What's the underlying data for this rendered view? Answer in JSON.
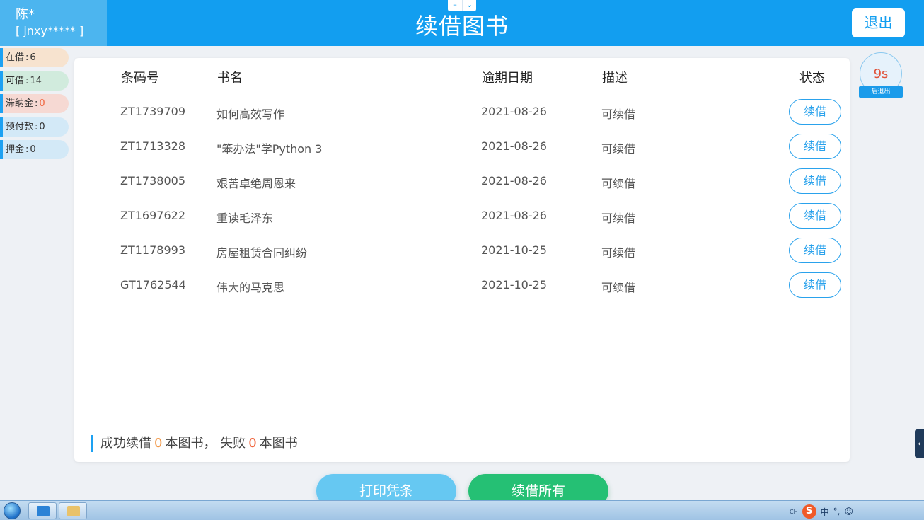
{
  "header": {
    "user_name": "陈*",
    "user_id": "[ jnxy***** ]",
    "title": "续借图书",
    "logout_label": "退出",
    "window_controls": [
      "–",
      "⌄"
    ]
  },
  "stats": [
    {
      "label": "在借",
      "value": "6"
    },
    {
      "label": "可借",
      "value": "14"
    },
    {
      "label": "滞纳金",
      "value": "0"
    },
    {
      "label": "预付款",
      "value": "0"
    },
    {
      "label": "押金",
      "value": "0"
    }
  ],
  "table": {
    "columns": [
      "条码号",
      "书名",
      "逾期日期",
      "描述",
      "状态"
    ],
    "rows": [
      {
        "barcode": "ZT1739709",
        "title": "如何高效写作",
        "due": "2021-08-26",
        "desc": "可续借",
        "action": "续借"
      },
      {
        "barcode": "ZT1713328",
        "title": "\"笨办法\"学Python 3",
        "due": "2021-08-26",
        "desc": "可续借",
        "action": "续借"
      },
      {
        "barcode": "ZT1738005",
        "title": "艰苦卓绝周恩来",
        "due": "2021-08-26",
        "desc": "可续借",
        "action": "续借"
      },
      {
        "barcode": "ZT1697622",
        "title": "重读毛泽东",
        "due": "2021-08-26",
        "desc": "可续借",
        "action": "续借"
      },
      {
        "barcode": "ZT1178993",
        "title": "房屋租赁合同纠纷",
        "due": "2021-10-25",
        "desc": "可续借",
        "action": "续借"
      },
      {
        "barcode": "GT1762544",
        "title": "伟大的马克思",
        "due": "2021-10-25",
        "desc": "可续借",
        "action": "续借"
      }
    ]
  },
  "summary": {
    "prefix": "成功续借",
    "success_count": "0",
    "middle": "本图书， 失败",
    "fail_count": "0",
    "suffix": "本图书"
  },
  "actions": {
    "print_label": "打印凭条",
    "renew_all_label": "续借所有"
  },
  "timer": {
    "value": "9s",
    "label": "后退出"
  },
  "side_tab": "‹",
  "taskbar": {
    "tray_lang": "CH",
    "tray_ime_logo": "S",
    "tray_ime_text": "中",
    "tray_punct": "°,",
    "tray_emoji": "☺"
  },
  "colors": {
    "accent": "#129ef0",
    "alert": "#f0643c",
    "count": "#f2994a",
    "print_button": "#66c8f2",
    "renew_all_button": "#25c074"
  },
  "icons": [
    "window-minimize-icon",
    "window-collapse-icon",
    "windows-start-icon",
    "app-icon",
    "folder-icon",
    "ime-logo-icon",
    "chevron-left-icon"
  ]
}
